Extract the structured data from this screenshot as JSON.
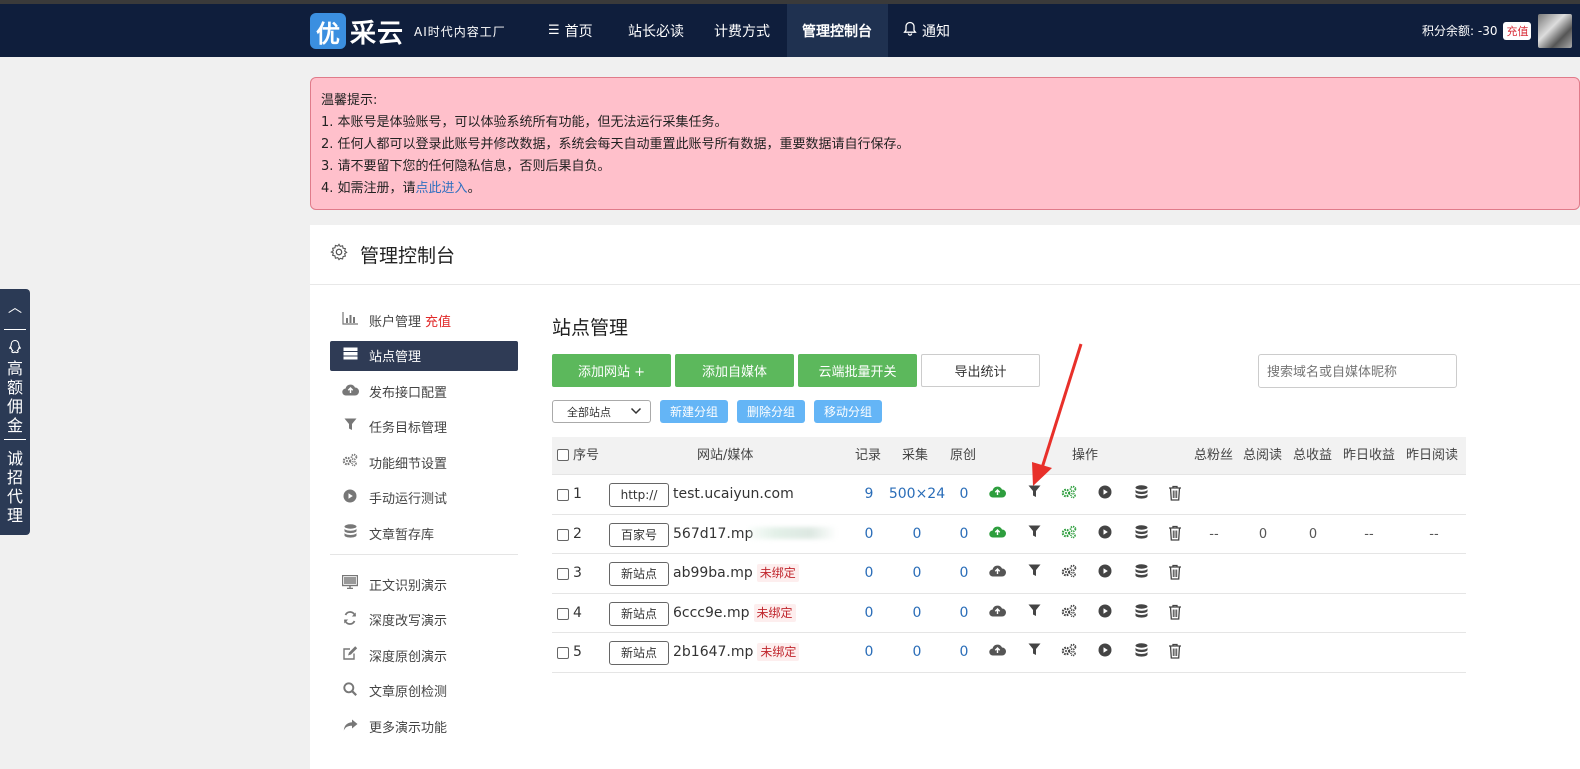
{
  "nav": {
    "logo_char": "优",
    "logo_name": "采云",
    "slogan": "AI时代内容工厂",
    "items": [
      {
        "label": "首页",
        "icon": "list-icon"
      },
      {
        "label": "站长必读"
      },
      {
        "label": "计费方式"
      },
      {
        "label": "管理控制台",
        "active": true
      },
      {
        "label": "通知",
        "icon": "bell-icon"
      }
    ],
    "score_label": "积分余额: -30",
    "recharge": "充值"
  },
  "side_float": {
    "text1": "高额佣金",
    "text2": "诚招代理"
  },
  "notice": {
    "title": "温馨提示:",
    "line1": "1. 本账号是体验账号，可以体验系统所有功能，但无法运行采集任务。",
    "line2": "2. 任何人都可以登录此账号并修改数据，系统会每天自动重置此账号所有数据，重要数据请自行保存。",
    "line3": "3. 请不要留下您的任何隐私信息，否则后果自负。",
    "line4_prefix": "4. 如需注册，请",
    "line4_link": "点此进入",
    "line4_suffix": "。"
  },
  "panel": {
    "title": "管理控制台"
  },
  "menu": {
    "items": [
      {
        "label": "账户管理",
        "extra": "充值",
        "icon": "bar-chart-icon"
      },
      {
        "label": "站点管理",
        "icon": "server-icon",
        "active": true
      },
      {
        "label": "发布接口配置",
        "icon": "cloud-upload-icon"
      },
      {
        "label": "任务目标管理",
        "icon": "filter-icon"
      },
      {
        "label": "功能细节设置",
        "icon": "gears-icon"
      },
      {
        "label": "手动运行测试",
        "icon": "play-icon"
      },
      {
        "label": "文章暂存库",
        "icon": "database-icon"
      }
    ],
    "demo_items": [
      {
        "label": "正文识别演示",
        "icon": "monitor-icon"
      },
      {
        "label": "深度改写演示",
        "icon": "refresh-icon"
      },
      {
        "label": "深度原创演示",
        "icon": "edit-icon"
      },
      {
        "label": "文章原创检测",
        "icon": "search-icon"
      },
      {
        "label": "更多演示功能",
        "icon": "share-icon"
      }
    ]
  },
  "content": {
    "title": "站点管理",
    "buttons": {
      "add_site": "添加网站 +",
      "add_media": "添加自媒体",
      "cloud_toggle": "云端批量开关",
      "export": "导出统计"
    },
    "search_placeholder": "搜索域名或自媒体昵称",
    "filter": {
      "select_value": "全部站点",
      "new_group": "新建分组",
      "delete_group": "删除分组",
      "move_group": "移动分组"
    },
    "table": {
      "headers": {
        "index": "序号",
        "site": "网站/媒体",
        "records": "记录",
        "collect": "采集",
        "original": "原创",
        "actions": "操作",
        "total_fans": "总粉丝",
        "total_reads": "总阅读",
        "total_income": "总收益",
        "yesterday_income": "昨日收益",
        "yesterday_reads": "昨日阅读"
      },
      "unbound_label": "未绑定",
      "rows": [
        {
          "index": "1",
          "tag": "http://",
          "name": "test.ucaiyun.com",
          "records": "9",
          "collect": "500×24",
          "original": "0",
          "cloud": "green",
          "stats": null
        },
        {
          "index": "2",
          "tag": "百家号",
          "name": "567d17.mp",
          "records": "0",
          "collect": "0",
          "original": "0",
          "cloud": "green",
          "stats": {
            "fans": "--",
            "reads": "0",
            "income": "0",
            "y_income": "--",
            "y_reads": "--"
          }
        },
        {
          "index": "3",
          "tag": "新站点",
          "name": "ab99ba.mp",
          "unbound": true,
          "records": "0",
          "collect": "0",
          "original": "0",
          "cloud": "gray",
          "stats": null
        },
        {
          "index": "4",
          "tag": "新站点",
          "name": "6ccc9e.mp",
          "unbound": true,
          "records": "0",
          "collect": "0",
          "original": "0",
          "cloud": "gray",
          "stats": null
        },
        {
          "index": "5",
          "tag": "新站点",
          "name": "2b1647.mp",
          "unbound": true,
          "records": "0",
          "collect": "0",
          "original": "0",
          "cloud": "gray",
          "stats": null
        }
      ]
    }
  },
  "colors": {
    "nav_bg": "#0f1e3c",
    "notice_bg": "#ffc0cb",
    "green_btn": "#5cb85c",
    "blue_btn": "#64b5f6",
    "link_num": "#2a6db8",
    "cloud_green": "#2e9e3e",
    "arrow_red": "#e8302a"
  }
}
